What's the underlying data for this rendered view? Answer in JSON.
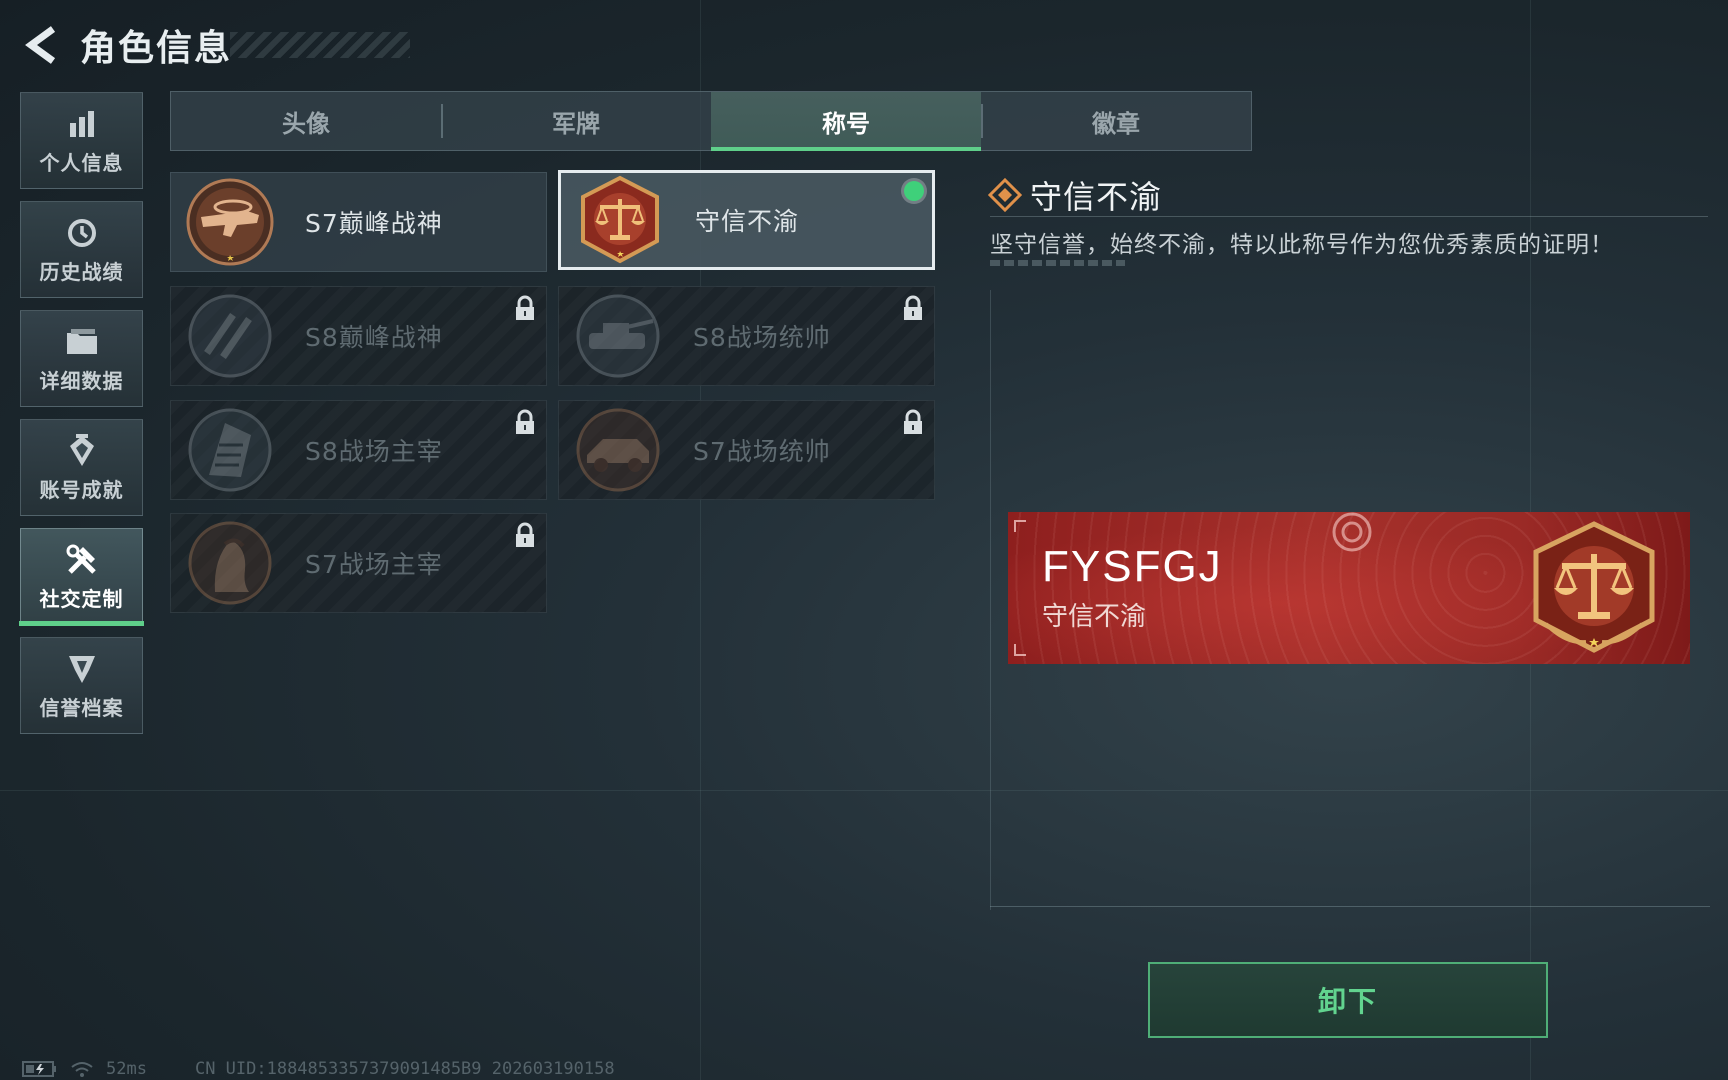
{
  "header": {
    "title": "角色信息"
  },
  "sidebar": {
    "items": [
      {
        "label": "个人信息",
        "icon": "bar-chart-icon"
      },
      {
        "label": "历史战绩",
        "icon": "history-icon"
      },
      {
        "label": "详细数据",
        "icon": "folder-icon"
      },
      {
        "label": "账号成就",
        "icon": "achievement-icon"
      },
      {
        "label": "社交定制",
        "icon": "tools-icon",
        "active": true
      },
      {
        "label": "信誉档案",
        "icon": "credit-icon"
      }
    ]
  },
  "tabs": [
    {
      "label": "头像"
    },
    {
      "label": "军牌"
    },
    {
      "label": "称号",
      "active": true
    },
    {
      "label": "徽章"
    }
  ],
  "titles": [
    {
      "name": "S7巅峰战神",
      "locked": false,
      "selected": false
    },
    {
      "name": "守信不渝",
      "locked": false,
      "selected": true,
      "equipped": true
    },
    {
      "name": "S8巅峰战神",
      "locked": true
    },
    {
      "name": "S8战场统帅",
      "locked": true
    },
    {
      "name": "S8战场主宰",
      "locked": true
    },
    {
      "name": "S7战场统帅",
      "locked": true
    },
    {
      "name": "S7战场主宰",
      "locked": true
    }
  ],
  "detail": {
    "title": "守信不渝",
    "description": "坚守信誉，始终不渝，特以此称号作为您优秀素质的证明！"
  },
  "nameplate": {
    "player_name": "FYSFGJ",
    "title": "守信不渝"
  },
  "actions": {
    "unequip_label": "卸下"
  },
  "status": {
    "ping": "52ms",
    "uid": "CN UID:1884853357379091485B9 202603190158"
  },
  "colors": {
    "accent_green": "#5fcf8a",
    "nameplate_red": "#a6302b",
    "equipped_dot": "#3fd07a"
  }
}
